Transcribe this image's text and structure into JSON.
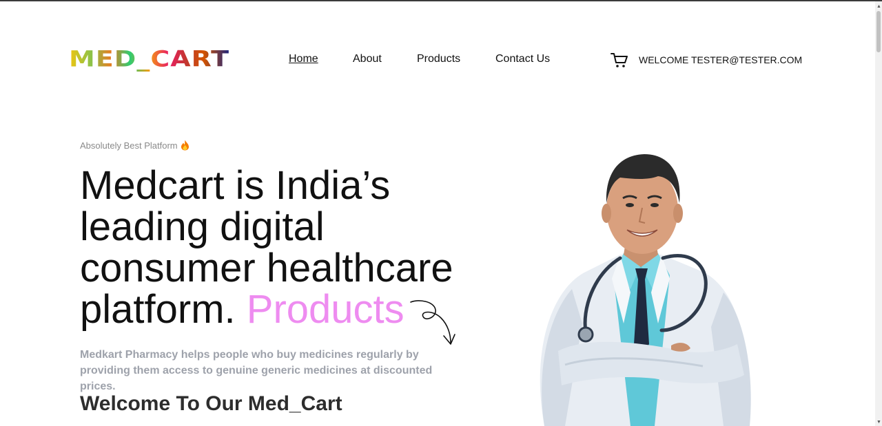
{
  "brand": {
    "logo_text": "MED_CART"
  },
  "nav": {
    "home": "Home",
    "about": "About",
    "products": "Products",
    "contact": "Contact Us"
  },
  "header": {
    "cart_icon": "shopping-cart-icon",
    "welcome_text": "WELCOME TESTER@TESTER.COM"
  },
  "hero": {
    "tagline": "Absolutely Best Platform",
    "tagline_icon": "fire-icon",
    "headline": "Medcart is India’s leading digital consumer healthcare platform.",
    "headline_accent": "Products",
    "accent_color": "#ee8cf0",
    "description": "Medkart Pharmacy helps people who buy medicines regularly by providing them access to genuine generic medicines at discounted prices.",
    "welcome_heading": "Welcome To Our Med_Cart",
    "image_icon": "doctor-illustration"
  }
}
